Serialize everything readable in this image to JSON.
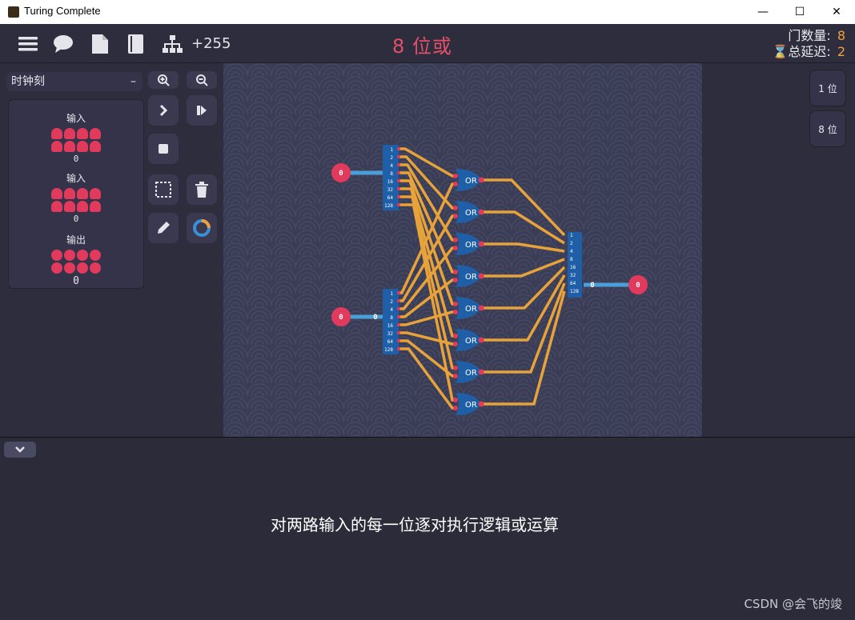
{
  "window": {
    "title": "Turing Complete",
    "minimize": "—",
    "maximize": "☐",
    "close": "✕"
  },
  "toolbar": {
    "score": "+255",
    "icons": [
      "menu-icon",
      "chat-icon",
      "document-icon",
      "book-icon",
      "hierarchy-icon"
    ]
  },
  "level": {
    "title": "8 位或"
  },
  "stats": {
    "gate_label": "门数量:",
    "gate_value": "8",
    "delay_label": "总延迟:",
    "delay_value": "2"
  },
  "left": {
    "dropdown": "时钟刻",
    "dropdown_toggle": "–",
    "components": [
      {
        "label": "输入",
        "value": "0"
      },
      {
        "label": "输入",
        "value": "0"
      },
      {
        "label": "输出",
        "value": "0"
      }
    ]
  },
  "canvas": {
    "input_a": "0",
    "input_b": "0",
    "input_b_bus": "0",
    "output": "0",
    "output_bus": "0",
    "bit_labels": [
      "1",
      "2",
      "4",
      "8",
      "16",
      "32",
      "64",
      "128"
    ],
    "gate_label": "OR"
  },
  "right": {
    "options": [
      "1 位",
      "8 位"
    ]
  },
  "description": "对两路输入的每一位逐对执行逻辑或运算",
  "watermark": "CSDN @会飞的竣",
  "colors": {
    "wire": "#e8a23a",
    "bus": "#4a9fd8",
    "gate": "#1e5fa8",
    "pin": "#e23a5c",
    "accent": "#e2506a",
    "stat": "#f0a040"
  }
}
